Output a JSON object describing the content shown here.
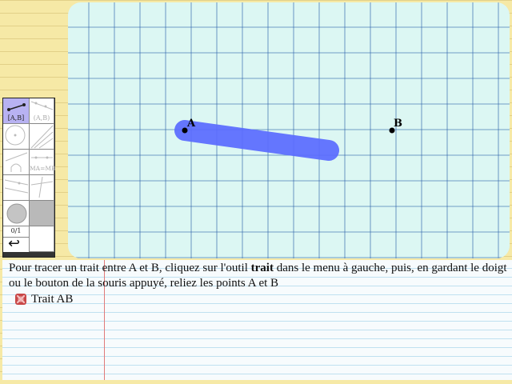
{
  "canvas": {
    "points": [
      {
        "id": "A",
        "label": "A"
      },
      {
        "id": "B",
        "label": "B"
      }
    ],
    "colors": {
      "background": "#dcf7f3",
      "grid": "#2a5fa8",
      "stroke": "#5a6cff"
    }
  },
  "toolbar": {
    "tools": [
      {
        "name": "segment-tool",
        "label": "[A,B]",
        "selected": true
      },
      {
        "name": "ray-tool",
        "label": "(A,B)"
      },
      {
        "name": "circle-tool",
        "label": ""
      },
      {
        "name": "lines-tool",
        "label": ""
      },
      {
        "name": "arc-tool",
        "label": ""
      },
      {
        "name": "perpendicular-bisector-tool",
        "label": "MA=MB"
      },
      {
        "name": "parallel-tool",
        "label": ""
      },
      {
        "name": "perpendicular-tool",
        "label": ""
      },
      {
        "name": "color-tool",
        "label": ""
      },
      {
        "name": "fill-tool",
        "label": ""
      },
      {
        "name": "counter",
        "label": "0/1"
      },
      {
        "name": "blank-tool",
        "label": ""
      },
      {
        "name": "undo-tool",
        "label": "↩"
      },
      {
        "name": "blank-tool-2",
        "label": ""
      }
    ]
  },
  "instructions": {
    "text_before": "Pour tracer un trait entre A et B, cliquez sur l'outil ",
    "bold_word": "trait",
    "text_after": " dans le menu à gauche, puis, en gardant le doigt ou le bouton de la souris appuyé, reliez les points A et B",
    "task_label": "Trait AB"
  }
}
